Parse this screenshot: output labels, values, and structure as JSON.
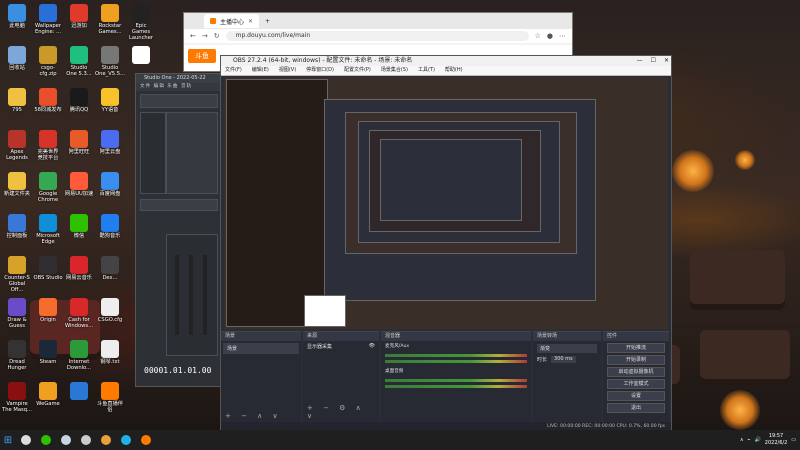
{
  "desktop_icons": [
    {
      "label": "此电脑",
      "color": "#3b8fe0",
      "col": 0,
      "row": 0
    },
    {
      "label": "Wallpaper\nEngine: ...",
      "color": "#2a6fd6",
      "col": 1,
      "row": 0
    },
    {
      "label": "迅游加",
      "color": "#e03a2a",
      "col": 2,
      "row": 0
    },
    {
      "label": "Rockstar\nGames...",
      "color": "#f0a020",
      "col": 3,
      "row": 0
    },
    {
      "label": "Epic Games\nLauncher",
      "color": "#222222",
      "col": 4,
      "row": 0
    },
    {
      "label": "回收站",
      "color": "#7da7d9",
      "col": 0,
      "row": 1
    },
    {
      "label": "csgo-cfg.zip",
      "color": "#c99a2a",
      "col": 1,
      "row": 1
    },
    {
      "label": "Studio\nOne 5.3...",
      "color": "#1fbf7f",
      "col": 2,
      "row": 1
    },
    {
      "label": "Studio\nOne_V5.5...",
      "color": "#777777",
      "col": 3,
      "row": 1
    },
    {
      "label": "",
      "color": "#ffffff",
      "col": 4,
      "row": 1
    },
    {
      "label": "795",
      "color": "#f0c040",
      "col": 0,
      "row": 2
    },
    {
      "label": "58同城发布",
      "color": "#e8502a",
      "col": 1,
      "row": 2
    },
    {
      "label": "腾讯QQ",
      "color": "#1a1a1a",
      "col": 2,
      "row": 2
    },
    {
      "label": "YY语音",
      "color": "#f7c22a",
      "col": 3,
      "row": 2
    },
    {
      "label": "Apex\nLegends",
      "color": "#b8342a",
      "col": 0,
      "row": 3
    },
    {
      "label": "完美世界\n竞技平台",
      "color": "#d6342a",
      "col": 1,
      "row": 3
    },
    {
      "label": "阿里旺旺",
      "color": "#e85a2a",
      "col": 2,
      "row": 3
    },
    {
      "label": "阿里云盘",
      "color": "#4b6cf0",
      "col": 3,
      "row": 3
    },
    {
      "label": "新建文件夹",
      "color": "#f0c040",
      "col": 0,
      "row": 4
    },
    {
      "label": "Google\nChrome",
      "color": "#34a853",
      "col": 1,
      "row": 4
    },
    {
      "label": "网易UU加速",
      "color": "#ff5a3a",
      "col": 2,
      "row": 4
    },
    {
      "label": "百度网盘",
      "color": "#3a8ef0",
      "col": 3,
      "row": 4
    },
    {
      "label": "控制面板",
      "color": "#3a78d8",
      "col": 0,
      "row": 5
    },
    {
      "label": "Microsoft\nEdge",
      "color": "#0f8fd8",
      "col": 1,
      "row": 5
    },
    {
      "label": "微信",
      "color": "#2dc100",
      "col": 2,
      "row": 5
    },
    {
      "label": "酷狗音乐",
      "color": "#1f7ef0",
      "col": 3,
      "row": 5
    },
    {
      "label": "Counter-S\nGlobal Off...",
      "color": "#d6a22a",
      "col": 0,
      "row": 6
    },
    {
      "label": "OBS Studio",
      "color": "#302e31",
      "col": 1,
      "row": 6
    },
    {
      "label": "网易云音乐",
      "color": "#d8262a",
      "col": 2,
      "row": 6
    },
    {
      "label": "Dex...",
      "color": "#444444",
      "col": 3,
      "row": 6
    },
    {
      "label": "Draw &\nGuess",
      "color": "#6a4cc8",
      "col": 0,
      "row": 7
    },
    {
      "label": "Origin",
      "color": "#f56c2d",
      "col": 1,
      "row": 7
    },
    {
      "label": "Cash for\nWindows...",
      "color": "#d62a2a",
      "col": 2,
      "row": 7
    },
    {
      "label": "CSGO.cfg",
      "color": "#eeeeee",
      "col": 3,
      "row": 7
    },
    {
      "label": "Dread\nHunger",
      "color": "#333333",
      "col": 0,
      "row": 8
    },
    {
      "label": "Steam",
      "color": "#1b2838",
      "col": 1,
      "row": 8
    },
    {
      "label": "Internet\nDownlo...",
      "color": "#2a9a3a",
      "col": 2,
      "row": 8
    },
    {
      "label": "钢琴.txt",
      "color": "#eeeeee",
      "col": 3,
      "row": 8
    },
    {
      "label": "Vampire\nThe Masq...",
      "color": "#8a1010",
      "col": 0,
      "row": 9
    },
    {
      "label": "WeGame",
      "color": "#f0a020",
      "col": 1,
      "row": 9
    },
    {
      "label": "",
      "color": "#2a78d6",
      "col": 2,
      "row": 9
    },
    {
      "label": "斗鱼直播伴侣",
      "color": "#ff7a00",
      "col": 3,
      "row": 9
    }
  ],
  "browser": {
    "tab_title": "主播中心",
    "url": "mp.douyu.com/live/main",
    "logo_text": "斗鱼"
  },
  "studio_one": {
    "title": "Studio One - 2022-05-22",
    "menu": "文件 编辑 乐曲 音轨",
    "time": "00001.01.01.00"
  },
  "obs": {
    "title": "OBS 27.2.4 (64-bit, windows) - 配置文件: 未命名 - 场景: 未命名",
    "menu": [
      "文件(F)",
      "编辑(E)",
      "视图(V)",
      "停靠窗口(D)",
      "配置文件(P)",
      "场景集合(S)",
      "工具(T)",
      "帮助(H)"
    ],
    "docks": {
      "scenes": "场景",
      "scenes_item": "场景",
      "sources": "来源",
      "sources_item": "显示器采集",
      "mixer": "混音器",
      "mixer_ch1": "麦克风/Aux",
      "mixer_ch2": "桌面音频",
      "transitions": "场景转场",
      "transition_type": "渐变",
      "duration_label": "时长",
      "duration_value": "300 ms",
      "controls": "控件",
      "control_buttons": [
        "开始推流",
        "开始录制",
        "启动虚拟摄像机",
        "工作室模式",
        "设置",
        "退出"
      ]
    },
    "status": "LIVE: 00:00:00   REC: 00:00:00   CPU: 0.7%, 60.00 fps"
  },
  "taskbar": {
    "time": "19:57",
    "date": "2022/6/2",
    "items": [
      {
        "name": "start",
        "color": "#39a0ff"
      },
      {
        "name": "search",
        "color": "#dddddd"
      },
      {
        "name": "wechat",
        "color": "#2dc100"
      },
      {
        "name": "steam",
        "color": "#c7d5e0"
      },
      {
        "name": "obs",
        "color": "#cccccc"
      },
      {
        "name": "chrome",
        "color": "#e8a03a"
      },
      {
        "name": "edge",
        "color": "#1fb1e8"
      },
      {
        "name": "douyu",
        "color": "#ff7a00"
      }
    ]
  }
}
